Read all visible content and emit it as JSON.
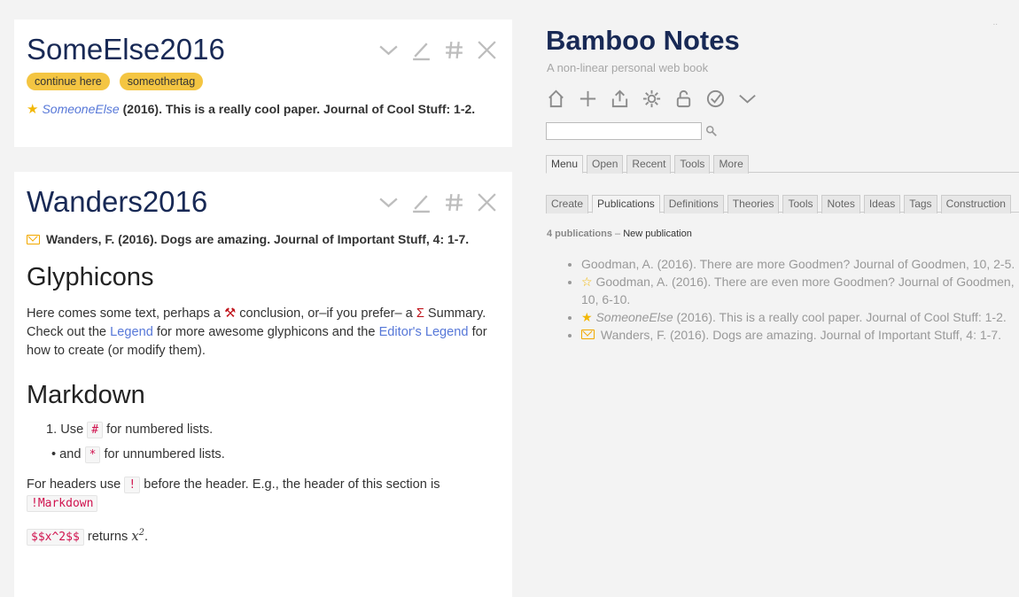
{
  "tiddler1": {
    "title": "SomeElse2016",
    "tags": [
      "continue here",
      "someothertag"
    ],
    "ref_author": "SomeoneElse",
    "ref_rest": "(2016). This is a really cool paper. Journal of Cool Stuff: 1-2."
  },
  "tiddler2": {
    "title": "Wanders2016",
    "ref": "Wanders, F. (2016). Dogs are amazing. Journal of Important Stuff, 4: 1-7.",
    "h_glyph": "Glyphicons",
    "p1_a": "Here comes some text, perhaps a",
    "p1_b": "conclusion, or–if you prefer– a",
    "p1_c": "Summary.",
    "p1_d": "Check out the",
    "p1_legend": "Legend",
    "p1_e": "for more awesome glyphicons and the",
    "p1_editor_legend": "Editor's Legend",
    "p1_f": "for how to create (or modify them).",
    "h_markdown": "Markdown",
    "li1_a": "Use",
    "li1_code": "#",
    "li1_b": "for numbered lists.",
    "li2_a": "and",
    "li2_code": "*",
    "li2_b": "for unnumbered lists.",
    "p2_a": "For headers use",
    "p2_code": "!",
    "p2_b": "before the header. E.g., the header of this section is",
    "p2_code2": "!Markdown",
    "p3_code": "$$x^2$$",
    "p3_b": "returns"
  },
  "site": {
    "title": "Bamboo Notes",
    "subtitle": "A non-linear personal web book",
    "search_placeholder": ""
  },
  "tabs_top": [
    "Menu",
    "Open",
    "Recent",
    "Tools",
    "More"
  ],
  "tabs_bottom": [
    "Create",
    "Publications",
    "Definitions",
    "Theories",
    "Tools",
    "Notes",
    "Ideas",
    "Tags",
    "Construction"
  ],
  "tabs_bottom_selected": "Publications",
  "publications": {
    "count_label": "4 publications",
    "new_label": "New publication",
    "items": [
      {
        "icon": "none",
        "text": "Goodman, A. (2016). There are more Goodmen? Journal of Goodmen, 10, 2-5."
      },
      {
        "icon": "star-outline",
        "text": "Goodman, A. (2016). There are even more Goodmen? Journal of Goodmen, 10, 6-10."
      },
      {
        "icon": "star",
        "author": "SomeoneElse",
        "text": "(2016). This is a really cool paper. Journal of Cool Stuff: 1-2."
      },
      {
        "icon": "envelope",
        "text": "Wanders, F. (2016). Dogs are amazing. Journal of Important Stuff, 4: 1-7."
      }
    ]
  },
  "colors": {
    "accent_title": "#182955",
    "tag_bg": "#f4c542",
    "link": "#5778d8",
    "code": "#d0124e",
    "star": "#f2b705"
  }
}
